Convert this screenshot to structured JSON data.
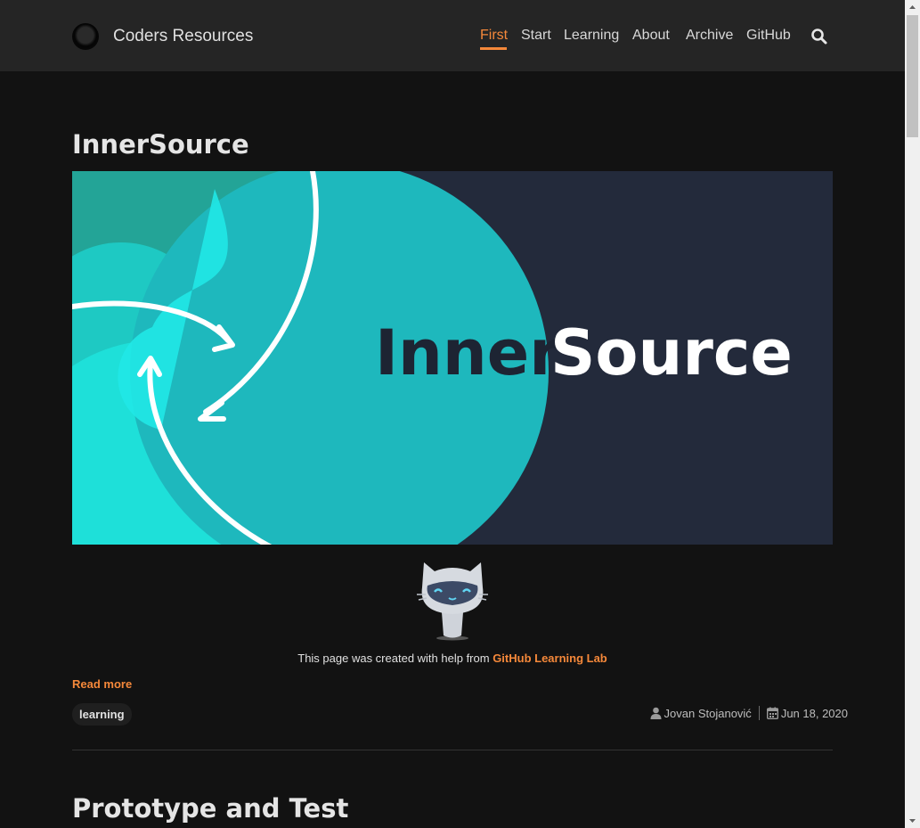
{
  "site": {
    "title": "Coders Resources"
  },
  "nav": {
    "items": [
      "First",
      "Start",
      "Learning",
      "About",
      "Archive",
      "GitHub"
    ],
    "active": "First"
  },
  "post": {
    "title": "InnerSource",
    "hero_text_dark": "Inner",
    "hero_text_light": "Source",
    "credit_prefix": "This page was created with help from ",
    "credit_link": "GitHub Learning Lab",
    "read_more": "Read more",
    "tag": "learning",
    "author": "Jovan Stojanović",
    "date": "Jun 18, 2020"
  },
  "next_post": {
    "title": "Prototype and Test"
  },
  "colors": {
    "accent": "#f5883a",
    "background": "#121212",
    "header": "#252525",
    "hero_teal": "#20b8bd",
    "hero_navy": "#232a3b"
  },
  "icons": [
    "logo-icon",
    "search-icon",
    "octocat-icon",
    "user-icon",
    "calendar-icon"
  ]
}
